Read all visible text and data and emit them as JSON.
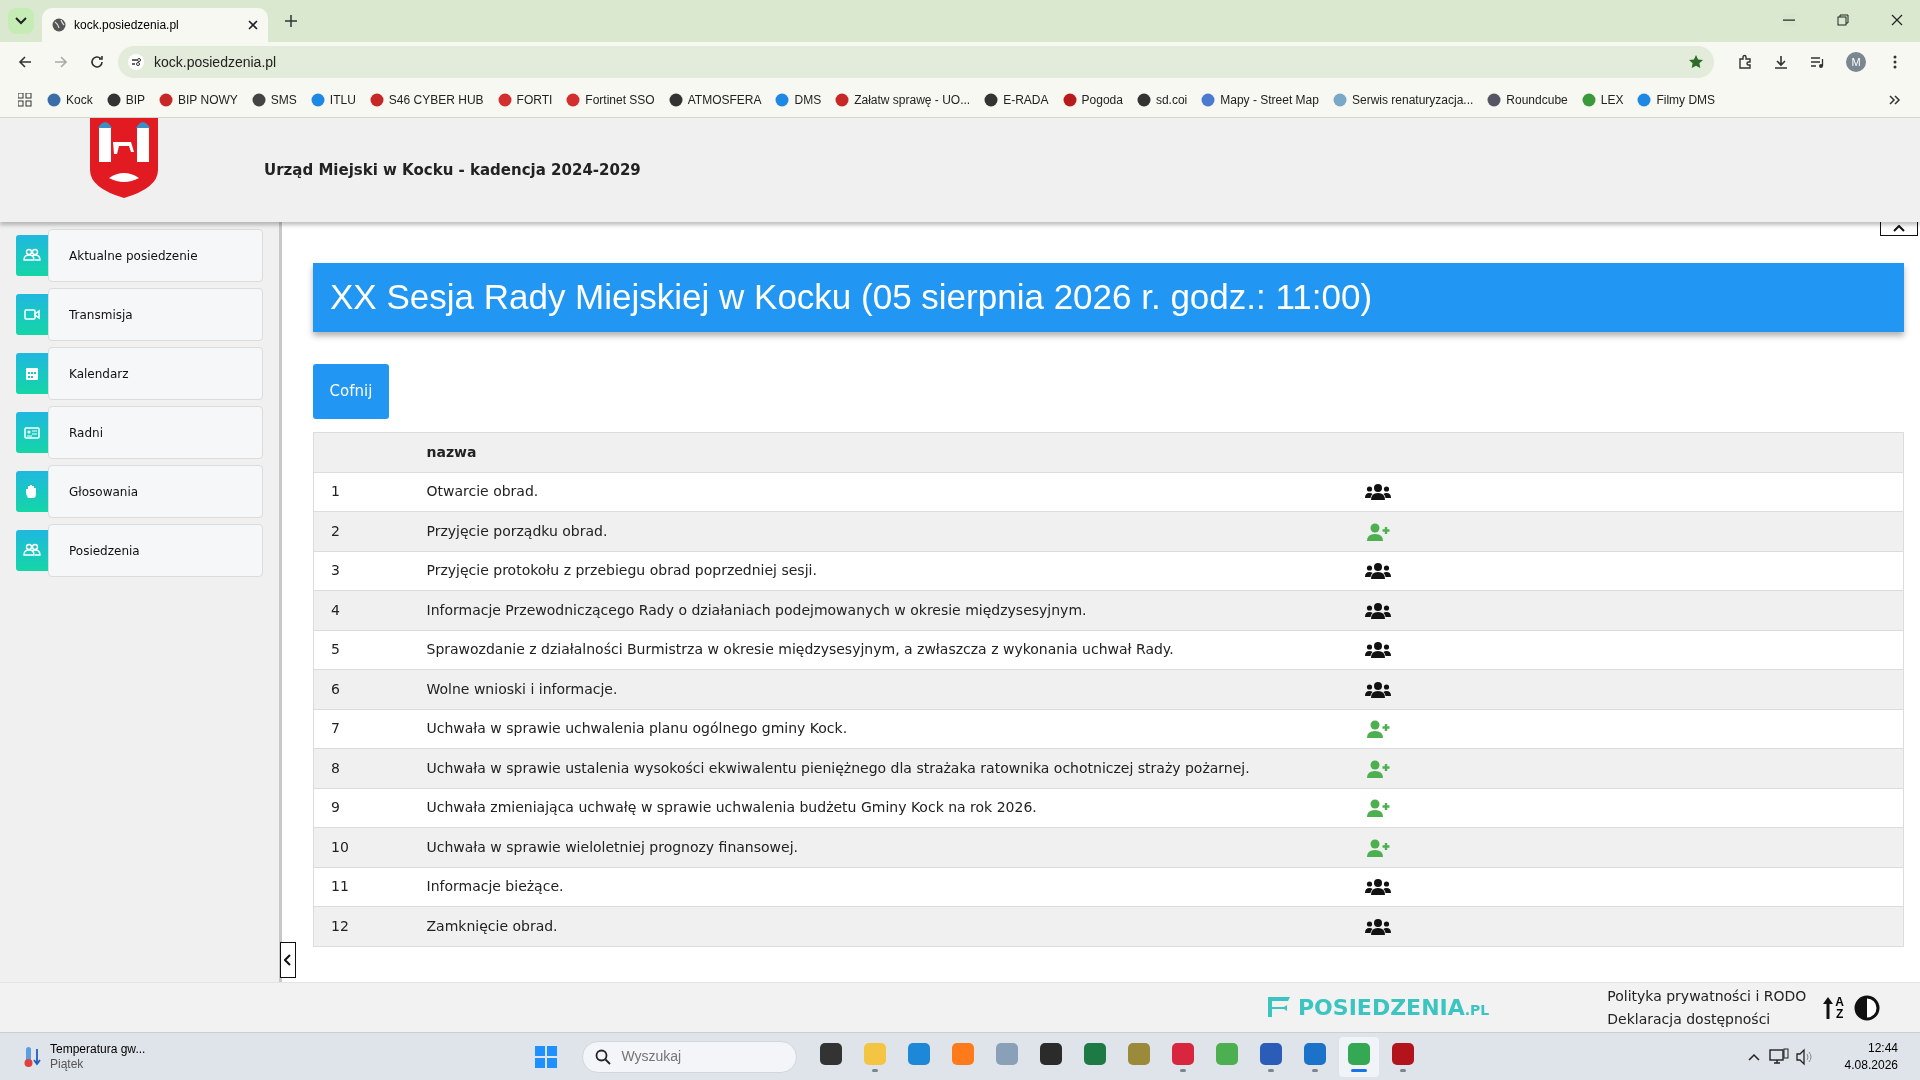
{
  "browser": {
    "tabs": [
      {
        "title": "kock.posiedzenia.pl",
        "selected": true
      }
    ],
    "address": "kock.posiedzenia.pl",
    "bookmarked": true,
    "profile": "M",
    "bookmarks": [
      "Kock",
      "BIP",
      "BIP NOWY",
      "SMS",
      "ITLU",
      "S46 CYBER HUB",
      "FORTI",
      "Fortinet SSO",
      "ATMOSFERA",
      "DMS",
      "Załatw sprawę - UO...",
      "E-RADA",
      "Pogoda",
      "sd.coi",
      "Mapy - Street Map",
      "Serwis renaturyzacja...",
      "Roundcube",
      "LEX",
      "Filmy DMS"
    ]
  },
  "header": {
    "title": "Urząd Miejski w Kocku - kadencja 2024-2029"
  },
  "sidebar": {
    "items": [
      {
        "label": "Aktualne posiedzenie",
        "kind": "people"
      },
      {
        "label": "Transmisja",
        "kind": "camera"
      },
      {
        "label": "Kalendarz",
        "kind": "calendar"
      },
      {
        "label": "Radni",
        "kind": "card"
      },
      {
        "label": "Głosowania",
        "kind": "hand"
      },
      {
        "label": "Posiedzenia",
        "kind": "people"
      }
    ]
  },
  "page": {
    "title": "XX Sesja Rady Miejskiej w Kocku (05 sierpnia 2026 r. godz.: 11:00)",
    "back_button": "Cofnij"
  },
  "table": {
    "columns": [
      "",
      "nazwa",
      ""
    ],
    "rows": [
      {
        "number": "1",
        "name": "Otwarcie obrad.",
        "kind": "group"
      },
      {
        "number": "2",
        "name": "Przyjęcie porządku obrad.",
        "kind": "add"
      },
      {
        "number": "3",
        "name": "Przyjęcie protokołu z przebiegu obrad poprzedniej sesji.",
        "kind": "group"
      },
      {
        "number": "4",
        "name": "Informacje Przewodniczącego Rady o działaniach podejmowanych w okresie międzysesyjnym.",
        "kind": "group"
      },
      {
        "number": "5",
        "name": "Sprawozdanie z działalności Burmistrza w okresie międzysesyjnym, a zwłaszcza z wykonania uchwał Rady.",
        "kind": "group"
      },
      {
        "number": "6",
        "name": "Wolne wnioski i informacje.",
        "kind": "group"
      },
      {
        "number": "7",
        "name": "Uchwała w sprawie uchwalenia planu ogólnego gminy Kock.",
        "kind": "add"
      },
      {
        "number": "8",
        "name": "Uchwała w sprawie ustalenia wysokości ekwiwalentu pieniężnego dla strażaka ratownika ochotniczej straży pożarnej.",
        "kind": "add"
      },
      {
        "number": "9",
        "name": "Uchwała zmieniająca uchwałę w sprawie uchwalenia budżetu Gminy Kock na rok 2026.",
        "kind": "add"
      },
      {
        "number": "10",
        "name": "Uchwała w sprawie wieloletniej prognozy finansowej.",
        "kind": "add"
      },
      {
        "number": "11",
        "name": "Informacje bieżące.",
        "kind": "group"
      },
      {
        "number": "12",
        "name": "Zamknięcie obrad.",
        "kind": "group"
      }
    ]
  },
  "footer": {
    "logo": "POSIEDZENIA",
    "logo_suffix": ".PL",
    "links": [
      "Polityka prywatności i RODO",
      "Deklaracja dostępności"
    ],
    "sort_letters": [
      "A",
      "Z"
    ]
  },
  "taskbar": {
    "weather": "Temperatura gw...",
    "weather_day": "Piątek",
    "search_placeholder": "Wyszukaj",
    "time": "12:44",
    "date": "4.08.2026",
    "apps": [
      {
        "color": "#333333",
        "running": false,
        "selected": false
      },
      {
        "color": "#f4c542",
        "running": true,
        "selected": false
      },
      {
        "color": "#1e88d8",
        "running": false,
        "selected": false
      },
      {
        "color": "#ff7a1a",
        "running": false,
        "selected": false
      },
      {
        "color": "#8aa0b8",
        "running": false,
        "selected": false
      },
      {
        "color": "#2b2b2b",
        "running": false,
        "selected": false
      },
      {
        "color": "#1d7a45",
        "running": false,
        "selected": false
      },
      {
        "color": "#9a8a3a",
        "running": false,
        "selected": false
      },
      {
        "color": "#d7263d",
        "running": true,
        "selected": false
      },
      {
        "color": "#4caf50",
        "running": false,
        "selected": false
      },
      {
        "color": "#2b5cb8",
        "running": true,
        "selected": false
      },
      {
        "color": "#1a73c9",
        "running": true,
        "selected": false
      },
      {
        "color": "#34a853",
        "running": true,
        "selected": true
      },
      {
        "color": "#b3141b",
        "running": true,
        "selected": false
      }
    ]
  }
}
